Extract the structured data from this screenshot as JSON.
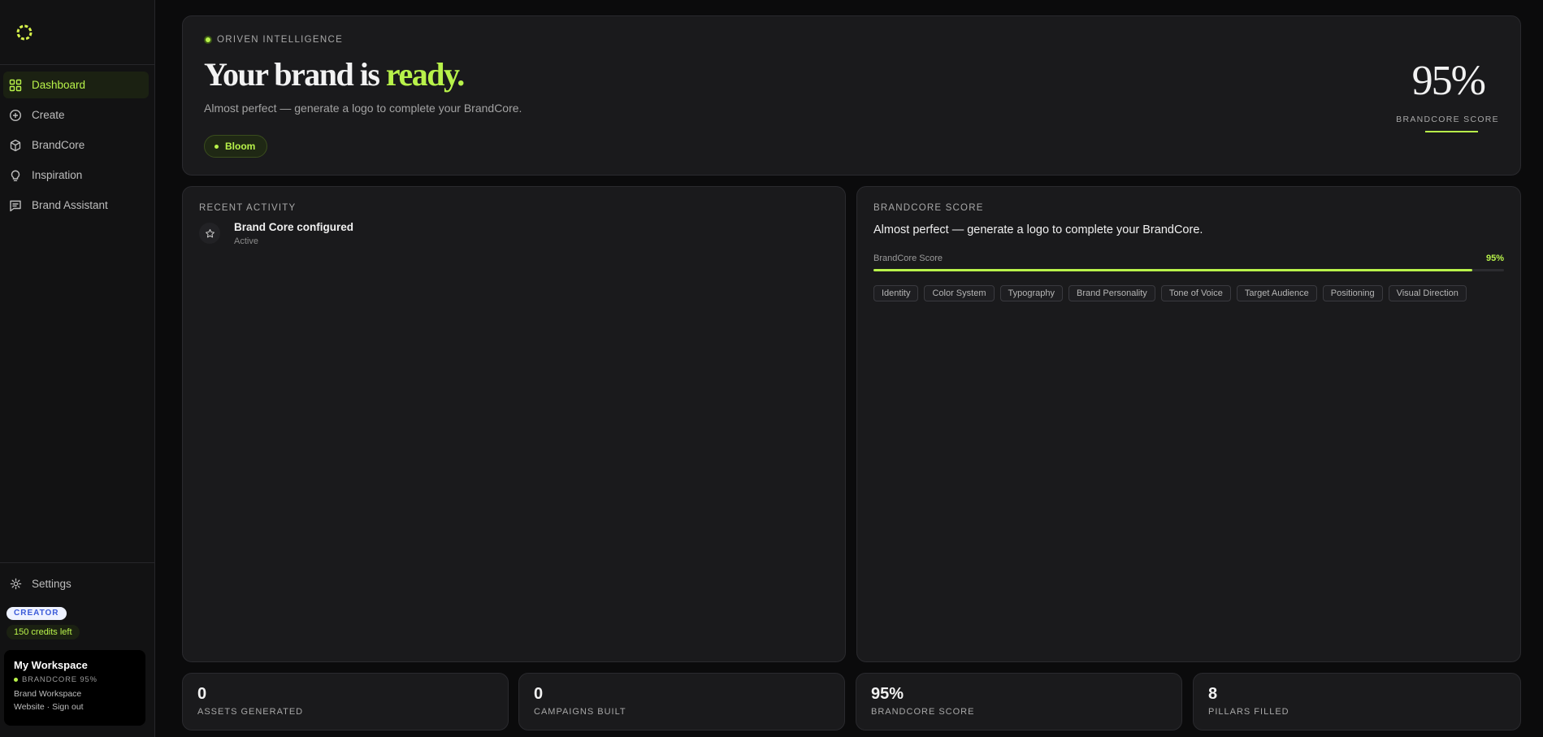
{
  "sidebar": {
    "nav": [
      {
        "label": "Dashboard",
        "icon": "grid-icon",
        "active": true
      },
      {
        "label": "Create",
        "icon": "plus-circle-icon"
      },
      {
        "label": "BrandCore",
        "icon": "cube-icon"
      },
      {
        "label": "Inspiration",
        "icon": "lightbulb-icon"
      },
      {
        "label": "Brand Assistant",
        "icon": "chat-icon"
      }
    ],
    "settings_label": "Settings",
    "plan": "CREATOR",
    "credits": "150 credits left",
    "workspace": {
      "name": "My Workspace",
      "score": "BRANDCORE 95%",
      "type": "Brand Workspace",
      "links": "Website · Sign out"
    }
  },
  "hero": {
    "eyebrow": "ORIVEN INTELLIGENCE",
    "title_prefix": "Your brand is ",
    "title_accent": "ready.",
    "subtitle": "Almost perfect — generate a logo to complete your BrandCore.",
    "stage": "Bloom",
    "score": "95%",
    "score_label": "BRANDCORE SCORE"
  },
  "activity": {
    "title": "RECENT ACTIVITY",
    "items": [
      {
        "title": "Brand Core configured",
        "status": "Active",
        "icon": "star-icon"
      }
    ]
  },
  "brandcore": {
    "title": "BRANDCORE SCORE",
    "description": "Almost perfect — generate a logo to complete your BrandCore.",
    "bar_label": "BrandCore Score",
    "bar_value": "95%",
    "progress": 0.95,
    "pillars": [
      "Identity",
      "Color System",
      "Typography",
      "Brand Personality",
      "Tone of Voice",
      "Target Audience",
      "Positioning",
      "Visual Direction"
    ]
  },
  "stats": [
    {
      "value": "0",
      "label": "ASSETS GENERATED"
    },
    {
      "value": "0",
      "label": "CAMPAIGNS BUILT"
    },
    {
      "value": "95%",
      "label": "BRANDCORE SCORE"
    },
    {
      "value": "8",
      "label": "PILLARS FILLED"
    }
  ],
  "colors": {
    "accent": "#b8f24a",
    "background": "#0b0b0c",
    "card": "#1a1a1c",
    "plan_badge": "#3b5bd9"
  }
}
